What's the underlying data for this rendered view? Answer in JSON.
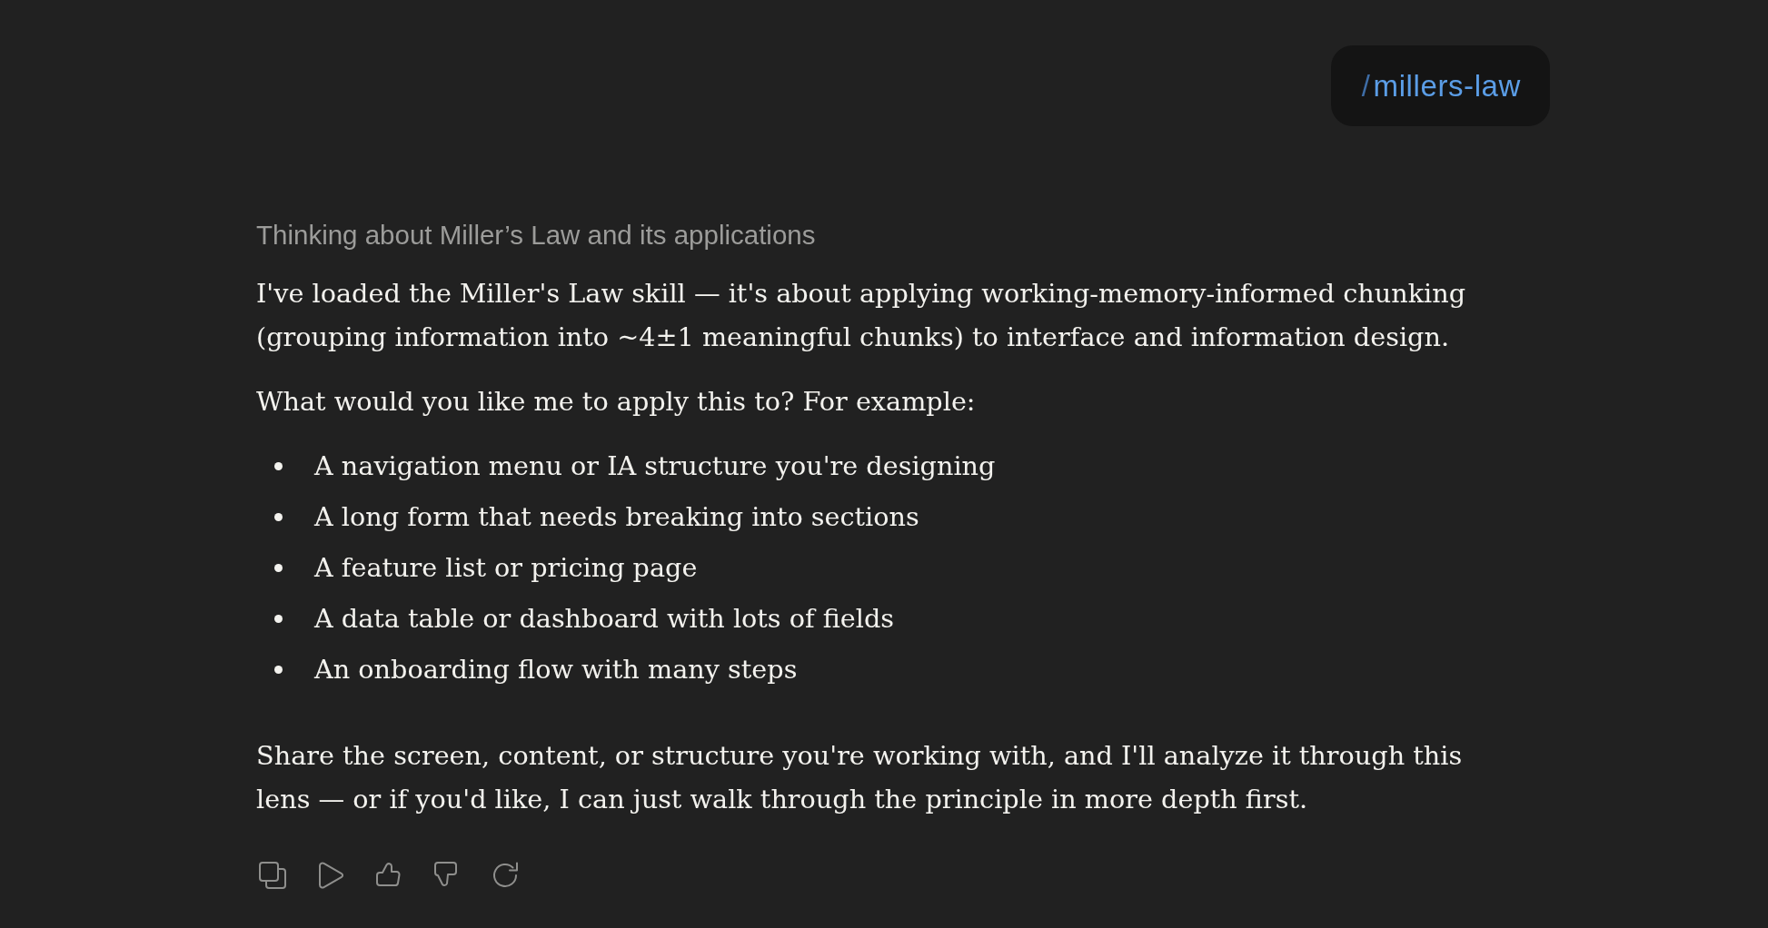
{
  "user_message": {
    "prefix": "/",
    "command": "millers-law"
  },
  "thinking": {
    "label": "Thinking about Miller’s Law and its applications"
  },
  "response": {
    "blocks": [
      {
        "kind": "paragraph",
        "text": "I've loaded the Miller's Law skill — it's about applying working-memory-informed chunking (grouping information into ~4±1 meaningful chunks) to interface and information design."
      },
      {
        "kind": "paragraph",
        "text": "What would you like me to apply this to? For example:"
      },
      {
        "kind": "list",
        "items": [
          "A navigation menu or IA structure you're designing",
          "A long form that needs breaking into sections",
          "A feature list or pricing page",
          "A data table or dashboard with lots of fields",
          "An onboarding flow with many steps"
        ]
      },
      {
        "kind": "paragraph",
        "text": "Share the screen, content, or structure you're working with, and I'll analyze it through this lens — or if you'd like, I can just walk through the principle in more depth first."
      }
    ]
  }
}
